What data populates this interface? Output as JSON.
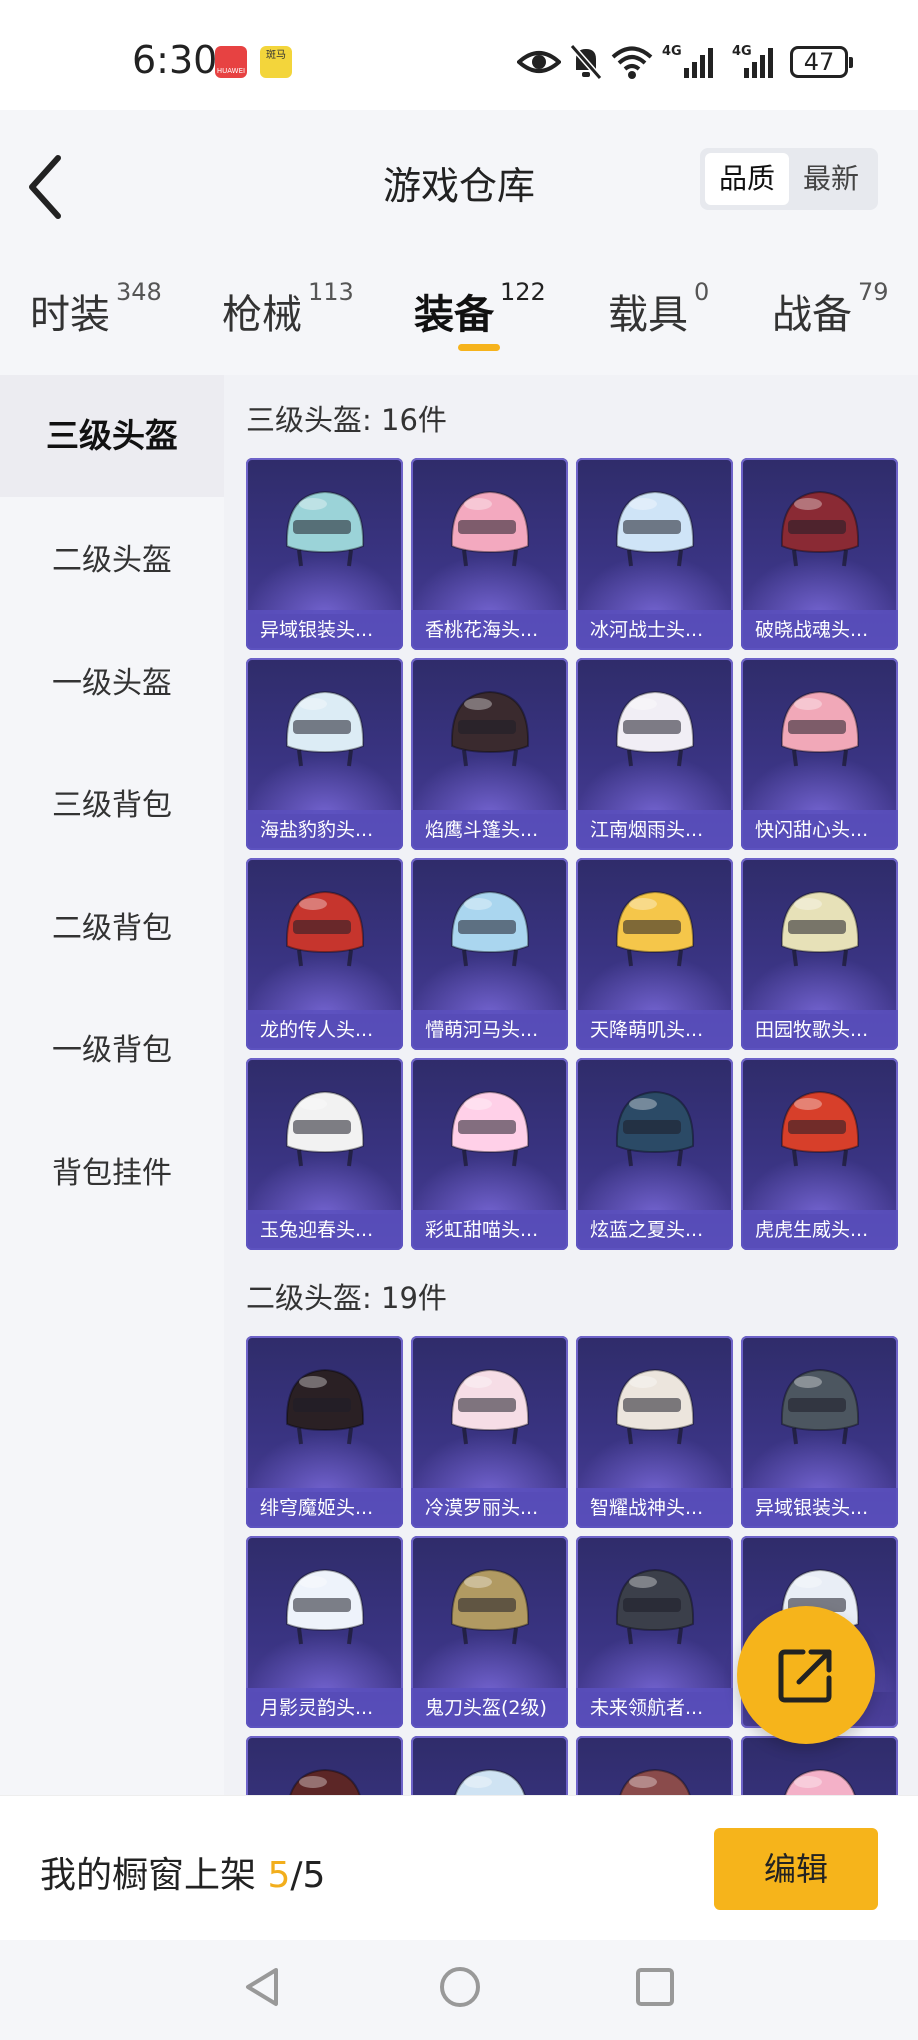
{
  "status_bar": {
    "time": "6:30",
    "app_icon_1": "HUAWEI",
    "app_icon_2": "斑马",
    "net1": "4G",
    "net2": "4G",
    "battery": "47"
  },
  "header": {
    "title": "游戏仓库",
    "sort_options": [
      "品质",
      "最新"
    ],
    "sort_active": "品质"
  },
  "tabs": [
    {
      "label": "时装",
      "count": "348"
    },
    {
      "label": "枪械",
      "count": "113"
    },
    {
      "label": "装备",
      "count": "122"
    },
    {
      "label": "载具",
      "count": "0"
    },
    {
      "label": "战备",
      "count": "79"
    }
  ],
  "sidebar": [
    "三级头盔",
    "二级头盔",
    "一级头盔",
    "三级背包",
    "二级背包",
    "一级背包",
    "背包挂件"
  ],
  "sections": [
    {
      "title": "三级头盔: 16件",
      "items": [
        {
          "name": "异域银装头...",
          "color": "#9bd3d8"
        },
        {
          "name": "香桃花海头...",
          "color": "#f3a9bf"
        },
        {
          "name": "冰河战士头...",
          "color": "#cfe4f7"
        },
        {
          "name": "破晓战魂头...",
          "color": "#8a2a34"
        },
        {
          "name": "海盐豹豹头...",
          "color": "#dcecf5"
        },
        {
          "name": "焰鹰斗篷头...",
          "color": "#3a2a2e"
        },
        {
          "name": "江南烟雨头...",
          "color": "#f1eef5"
        },
        {
          "name": "快闪甜心头...",
          "color": "#f1a8b8"
        },
        {
          "name": "龙的传人头...",
          "color": "#c6352d"
        },
        {
          "name": "懵萌河马头...",
          "color": "#aad6ef"
        },
        {
          "name": "天降萌叽头...",
          "color": "#f5c64a"
        },
        {
          "name": "田园牧歌头...",
          "color": "#e7e1b8"
        },
        {
          "name": "玉兔迎春头...",
          "color": "#f2f2f2"
        },
        {
          "name": "彩虹甜喵头...",
          "color": "#ffd0e8"
        },
        {
          "name": "炫蓝之夏头...",
          "color": "#2b4a66"
        },
        {
          "name": "虎虎生威头...",
          "color": "#d73f2a"
        }
      ]
    },
    {
      "title": "二级头盔: 19件",
      "items": [
        {
          "name": "绯穹魔姬头...",
          "color": "#2a2024"
        },
        {
          "name": "冷漠罗丽头...",
          "color": "#f6dde6"
        },
        {
          "name": "智耀战神头...",
          "color": "#ece5dd"
        },
        {
          "name": "异域银装头...",
          "color": "#4c5660"
        },
        {
          "name": "月影灵韵头...",
          "color": "#eef3fb"
        },
        {
          "name": "鬼刀头盔(2级)",
          "color": "#b19a62"
        },
        {
          "name": "未来领航者...",
          "color": "#3b3f4a"
        },
        {
          "name": "",
          "color": "#e9eef6"
        },
        {
          "name": "",
          "color": "#5c2626"
        },
        {
          "name": "",
          "color": "#cfe3f3"
        },
        {
          "name": "",
          "color": "#8a4b4b"
        },
        {
          "name": "",
          "color": "#f4b1c8"
        }
      ]
    }
  ],
  "bottom": {
    "label": "我的橱窗上架",
    "count": "5",
    "total": "/5",
    "edit": "编辑"
  }
}
